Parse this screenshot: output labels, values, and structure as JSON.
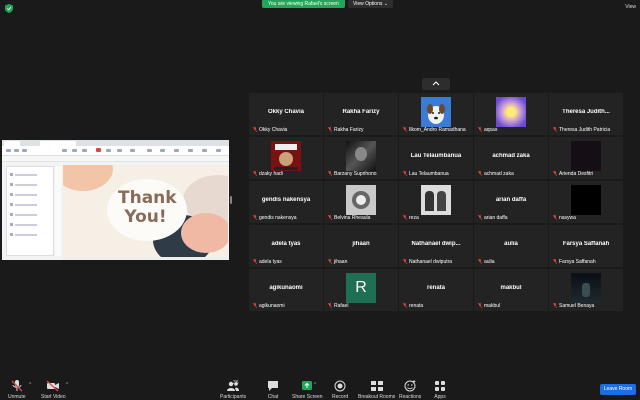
{
  "banner": {
    "viewing_text": "You are viewing Rafael's screen",
    "view_options_label": "View Options"
  },
  "top_right": {
    "view_label": "View"
  },
  "shared_screen": {
    "slide_text_line1": "Thank",
    "slide_text_line2": "You!"
  },
  "participants": [
    {
      "display": "Okky Chavia",
      "label": "Okky Chavia",
      "type": "name"
    },
    {
      "display": "Rakha Farizy",
      "label": "Rakha Farizy",
      "type": "name"
    },
    {
      "display": "",
      "label": "Ilkom_Andro Ramadhana",
      "type": "image-dog"
    },
    {
      "display": "",
      "label": "aqsas",
      "type": "image-blur"
    },
    {
      "display": "Theresa Judith...",
      "label": "Theresa Judith Patricia",
      "type": "name"
    },
    {
      "display": "",
      "label": "dzaky hadi",
      "type": "image-poster"
    },
    {
      "display": "",
      "label": "Barzany Suprihono",
      "type": "image-bw"
    },
    {
      "display": "Lau Telaumbanua",
      "label": "Lau Telaumbanua",
      "type": "name"
    },
    {
      "display": "achmad zaka",
      "label": "achmad zaka",
      "type": "name"
    },
    {
      "display": "",
      "label": "Arienda Desfitri",
      "type": "image-dark"
    },
    {
      "display": "gendis nakensya",
      "label": "gendis nakensya",
      "type": "name"
    },
    {
      "display": "",
      "label": "Belvina Rheaula",
      "type": "image-blob"
    },
    {
      "display": "",
      "label": "reza",
      "type": "image-pair"
    },
    {
      "display": "arian daffa",
      "label": "arian daffa",
      "type": "name"
    },
    {
      "display": "",
      "label": "nasywa",
      "type": "image-black"
    },
    {
      "display": "adela tyas",
      "label": "adela tyas",
      "type": "name"
    },
    {
      "display": "jihaan",
      "label": "jihaan",
      "type": "name"
    },
    {
      "display": "Nathanael dwip...",
      "label": "Nathanael dwiputra",
      "type": "name"
    },
    {
      "display": "aulia",
      "label": "aulia",
      "type": "name"
    },
    {
      "display": "Farsya Saffanah",
      "label": "Farsya Saffanah",
      "type": "name"
    },
    {
      "display": "agikunaomi",
      "label": "agikunaomi",
      "type": "name"
    },
    {
      "display": "R",
      "label": "Rafael",
      "type": "avatar"
    },
    {
      "display": "renata",
      "label": "renata",
      "type": "name"
    },
    {
      "display": "makbul",
      "label": "makbul",
      "type": "name"
    },
    {
      "display": "",
      "label": "Samuel Benaya",
      "type": "image-night"
    }
  ],
  "toolbar": {
    "unmute": "Unmute",
    "start_video": "Start Video",
    "participants": "Participants",
    "participants_count": "36",
    "chat": "Chat",
    "share_screen": "Share Screen",
    "record": "Record",
    "breakout_rooms": "Breakout Rooms",
    "reactions": "Reactions",
    "apps": "Apps",
    "leave": "Leave Room"
  },
  "colors": {
    "share_green": "#23a55a",
    "leave_blue": "#1a6fe6",
    "mic_red": "#e04a4a",
    "avatar_green": "#1f6f55"
  }
}
